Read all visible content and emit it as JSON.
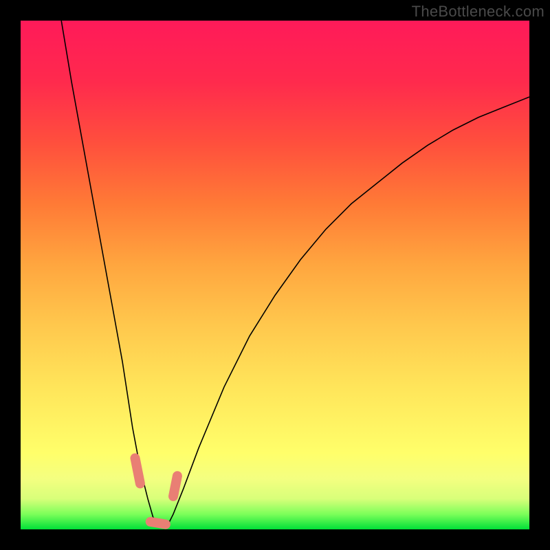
{
  "watermark": "TheBottleneck.com",
  "colors": {
    "frame": "#000000",
    "gradient_top": "#ff1a59",
    "gradient_bottom": "#00e038",
    "curve": "#000000",
    "dot": "#e97f74"
  },
  "chart_data": {
    "type": "line",
    "title": "",
    "xlabel": "",
    "ylabel": "",
    "xlim": [
      0,
      100
    ],
    "ylim": [
      0,
      100
    ],
    "notes": "V-shaped bottleneck curve reaching 0 near x≈27; two short capsule markers near the trough. Values estimated from pixel positions (0–100 scale, origin at bottom-left of colored plot).",
    "series": [
      {
        "name": "bottleneck-curve",
        "x": [
          8,
          10,
          12,
          14,
          16,
          18,
          20,
          22,
          23.5,
          25,
          26,
          27,
          28,
          29,
          30,
          32,
          35,
          40,
          45,
          50,
          55,
          60,
          65,
          70,
          75,
          80,
          85,
          90,
          95,
          100
        ],
        "y": [
          100,
          88,
          77,
          66,
          55,
          44,
          33,
          20,
          12,
          6,
          2.5,
          0.8,
          0.5,
          1,
          3,
          8,
          16,
          28,
          38,
          46,
          53,
          59,
          64,
          68,
          72,
          75.5,
          78.5,
          81,
          83,
          85
        ]
      }
    ],
    "markers": [
      {
        "name": "left-capsule",
        "x1": 22.5,
        "y1": 14,
        "x2": 23.5,
        "y2": 9
      },
      {
        "name": "trough-capsule",
        "x1": 25.5,
        "y1": 1.5,
        "x2": 28.5,
        "y2": 1.0
      },
      {
        "name": "right-capsule",
        "x1": 30.0,
        "y1": 6.5,
        "x2": 30.8,
        "y2": 10.5
      }
    ]
  }
}
